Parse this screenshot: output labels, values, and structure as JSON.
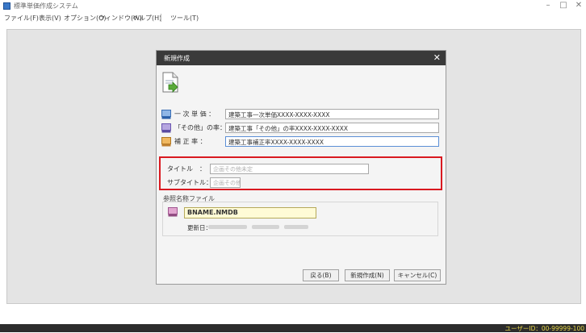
{
  "app": {
    "title": "標準単価作成システム"
  },
  "menu": [
    "ファイル(F)",
    "表示(V)",
    "オプション(O)",
    "ウィンドウ(W)",
    "ヘルプ(H)",
    "ツール(T)"
  ],
  "window_controls": {
    "minimize": "–",
    "maximize": "□",
    "close": "✕"
  },
  "dialog": {
    "title": "新規作成",
    "close": "✕",
    "fields": [
      {
        "label": "一 次 単 価 ：",
        "value": "建築工事一次単価XXXX-XXXX-XXXX"
      },
      {
        "label": "「その他」の率：",
        "value": "建築工事「その他」の率XXXX-XXXX-XXXX"
      },
      {
        "label": "補 正 率 ：",
        "value": "建築工事補正率XXXX-XXXX-XXXX"
      }
    ],
    "title_label": "タイトル　：",
    "title_placeholder": "企画その他未定",
    "subtitle_label": "サブタイトル：",
    "subtitle_placeholder": "企画その他未定",
    "ref_group_label": "参照名称ファイル",
    "ref_file": "BNAME.NMDB",
    "ref_date_label": "更新日：",
    "buttons": {
      "back": "戻る(B)",
      "create": "新規作成(N)",
      "cancel": "キャンセル(C)"
    }
  },
  "status": {
    "user_id": "ユーザーID：00-99999-100"
  }
}
